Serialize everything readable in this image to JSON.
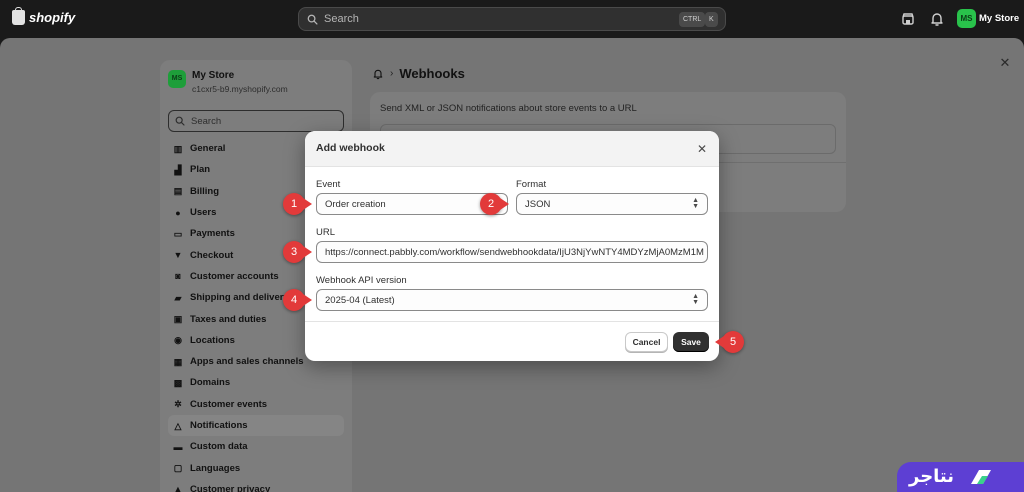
{
  "topbar": {
    "logo_text": "shopify",
    "search_placeholder": "Search",
    "kbd_ctrl": "CTRL",
    "kbd_k": "K",
    "avatar_initials": "MS",
    "store_name": "My Store"
  },
  "sidebar": {
    "avatar_initials": "MS",
    "store_name": "My Store",
    "store_url": "c1cxr5-b9.myshopify.com",
    "search_placeholder": "Search",
    "items": [
      {
        "label": "General",
        "icon": "store-icon"
      },
      {
        "label": "Plan",
        "icon": "chart-icon"
      },
      {
        "label": "Billing",
        "icon": "billing-icon"
      },
      {
        "label": "Users",
        "icon": "users-icon"
      },
      {
        "label": "Payments",
        "icon": "payments-icon"
      },
      {
        "label": "Checkout",
        "icon": "cart-icon"
      },
      {
        "label": "Customer accounts",
        "icon": "person-icon"
      },
      {
        "label": "Shipping and delivery",
        "icon": "truck-icon"
      },
      {
        "label": "Taxes and duties",
        "icon": "tax-icon"
      },
      {
        "label": "Locations",
        "icon": "location-icon"
      },
      {
        "label": "Apps and sales channels",
        "icon": "apps-icon"
      },
      {
        "label": "Domains",
        "icon": "globe-icon"
      },
      {
        "label": "Customer events",
        "icon": "cursor-icon"
      },
      {
        "label": "Notifications",
        "icon": "bell-icon",
        "active": true
      },
      {
        "label": "Custom data",
        "icon": "database-icon"
      },
      {
        "label": "Languages",
        "icon": "language-icon"
      },
      {
        "label": "Customer privacy",
        "icon": "lock-icon"
      }
    ]
  },
  "page": {
    "breadcrumb_separator": "›",
    "title": "Webhooks",
    "card_description": "Send XML or JSON notifications about store events to a URL"
  },
  "modal": {
    "title": "Add webhook",
    "event_label": "Event",
    "event_value": "Order creation",
    "format_label": "Format",
    "format_value": "JSON",
    "url_label": "URL",
    "url_value": "https://connect.pabbly.com/workflow/sendwebhookdata/IjU3NjYwNTY4MDYzMjA0MzM1M",
    "api_label": "Webhook API version",
    "api_value": "2025-04 (Latest)",
    "cancel_label": "Cancel",
    "save_label": "Save"
  },
  "steps": [
    "1",
    "2",
    "3",
    "4",
    "5"
  ],
  "brand": {
    "text": "نتاجر"
  },
  "colors": {
    "accent_step": "#e23a3a",
    "save_button": "#303030",
    "brand": "#5d3fd3",
    "avatar": "#29c24b"
  }
}
